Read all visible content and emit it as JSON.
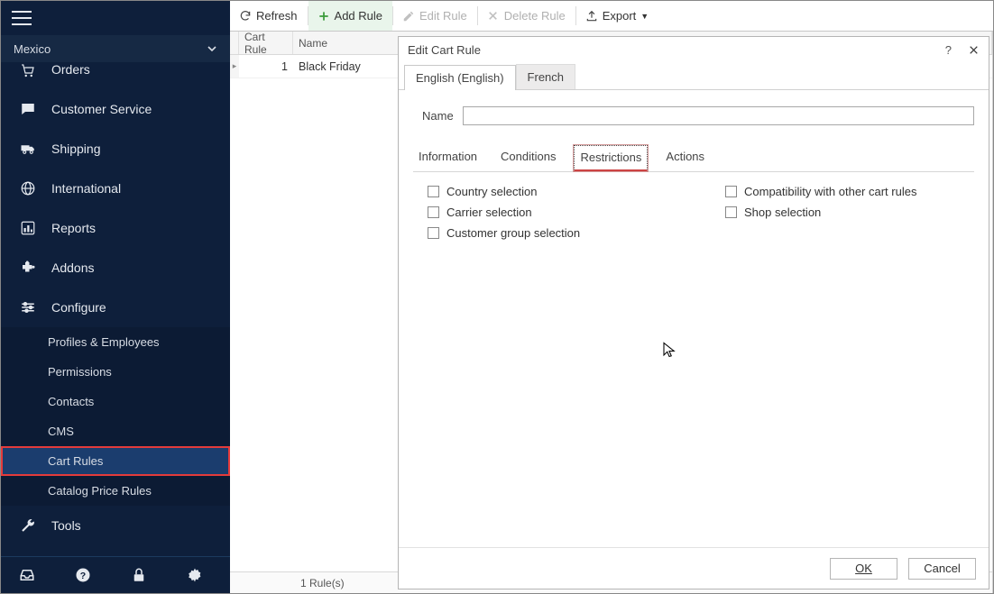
{
  "sidebar": {
    "region": "Mexico",
    "items": [
      {
        "label": "Orders",
        "icon": "cart"
      },
      {
        "label": "Customer Service",
        "icon": "chat"
      },
      {
        "label": "Shipping",
        "icon": "truck"
      },
      {
        "label": "International",
        "icon": "globe"
      },
      {
        "label": "Reports",
        "icon": "chart"
      },
      {
        "label": "Addons",
        "icon": "puzzle"
      },
      {
        "label": "Configure",
        "icon": "sliders"
      }
    ],
    "configure_subitems": [
      "Profiles & Employees",
      "Permissions",
      "Contacts",
      "CMS",
      "Cart Rules",
      "Catalog Price Rules"
    ],
    "tools_label": "Tools"
  },
  "toolbar": {
    "refresh": "Refresh",
    "add_rule": "Add Rule",
    "edit_rule": "Edit Rule",
    "delete_rule": "Delete Rule",
    "export": "Export"
  },
  "grid": {
    "columns": [
      "Cart Rule",
      "Name"
    ],
    "rows": [
      {
        "id": "1",
        "name": "Black Friday"
      }
    ],
    "status": "1 Rule(s)"
  },
  "dialog": {
    "title": "Edit Cart Rule",
    "lang_tabs": [
      "English (English)",
      "French"
    ],
    "active_lang": 0,
    "name_label": "Name",
    "name_value": "",
    "inner_tabs": [
      "Information",
      "Conditions",
      "Restrictions",
      "Actions"
    ],
    "active_inner_tab": 2,
    "restrictions_left": [
      "Country selection",
      "Carrier selection",
      "Customer group selection"
    ],
    "restrictions_right": [
      "Compatibility with other cart rules",
      "Shop selection"
    ],
    "ok": "OK",
    "cancel": "Cancel"
  }
}
